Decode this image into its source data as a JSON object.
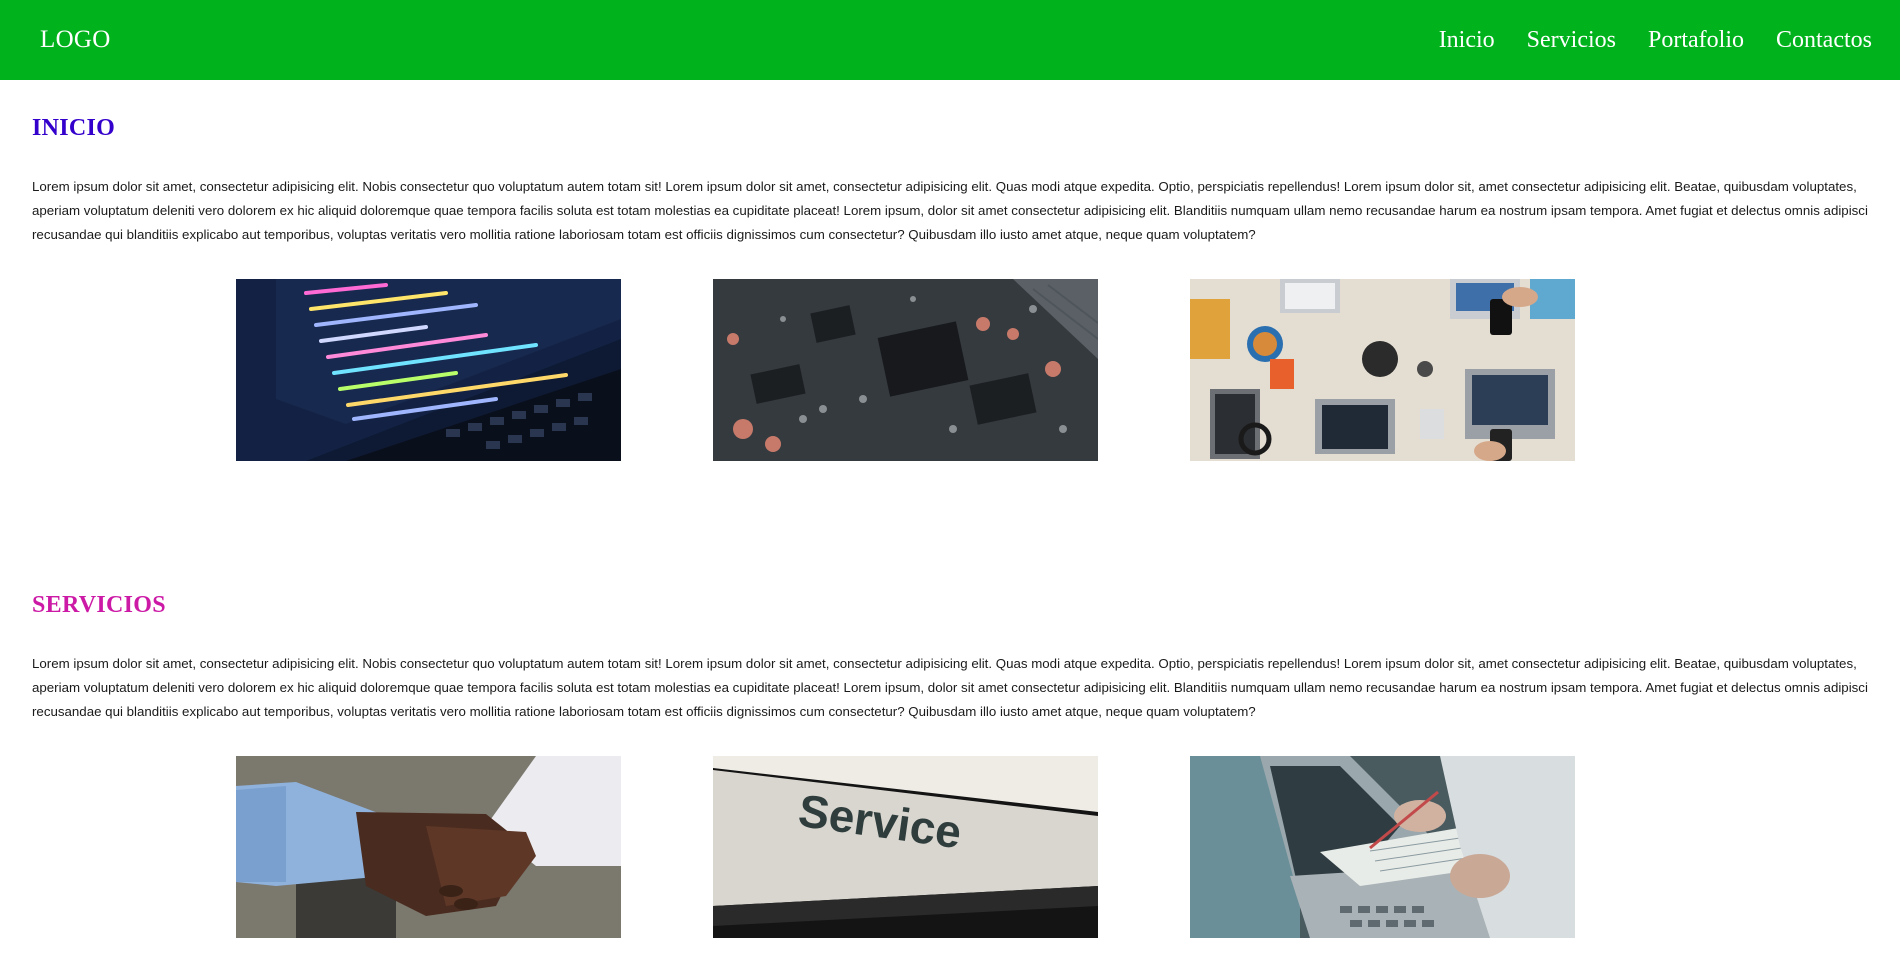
{
  "header": {
    "logo": "LOGO",
    "nav": [
      {
        "label": "Inicio"
      },
      {
        "label": "Servicios"
      },
      {
        "label": "Portafolio"
      },
      {
        "label": "Contactos"
      }
    ],
    "background_color": "#00b31c"
  },
  "sections": [
    {
      "title": "INICIO",
      "title_color": "#3300cc",
      "text": "Lorem ipsum dolor sit amet, consectetur adipisicing elit. Nobis consectetur quo voluptatum autem totam sit! Lorem ipsum dolor sit amet, consectetur adipisicing elit. Quas modi atque expedita. Optio, perspiciatis repellendus! Lorem ipsum dolor sit, amet consectetur adipisicing elit. Beatae, quibusdam voluptates, aperiam voluptatum deleniti vero dolorem ex hic aliquid doloremque quae tempora facilis soluta est totam molestias ea cupiditate placeat! Lorem ipsum, dolor sit amet consectetur adipisicing elit. Blanditiis numquam ullam nemo recusandae harum ea nostrum ipsam tempora. Amet fugiat et delectus omnis adipisci recusandae qui blanditiis explicabo aut temporibus, voluptas veritatis vero mollitia ratione laboriosam totam est officiis dignissimos cum consectetur? Quibusdam illo iusto amet atque, neque quam voluptatem?",
      "images": [
        "code-laptop-photo",
        "circuit-board-photo",
        "team-laptops-desk-photo"
      ]
    },
    {
      "title": "SERVICIOS",
      "title_color": "#cc1aa6",
      "text": "Lorem ipsum dolor sit amet, consectetur adipisicing elit. Nobis consectetur quo voluptatum autem totam sit! Lorem ipsum dolor sit amet, consectetur adipisicing elit. Quas modi atque expedita. Optio, perspiciatis repellendus! Lorem ipsum dolor sit, amet consectetur adipisicing elit. Beatae, quibusdam voluptates, aperiam voluptatum deleniti vero dolorem ex hic aliquid doloremque quae tempora facilis soluta est totam molestias ea cupiditate placeat! Lorem ipsum, dolor sit amet consectetur adipisicing elit. Blanditiis numquam ullam nemo recusandae harum ea nostrum ipsam tempora. Amet fugiat et delectus omnis adipisci recusandae qui blanditiis explicabo aut temporibus, voluptas veritatis vero mollitia ratione laboriosam totam est officiis dignissimos cum consectetur? Quibusdam illo iusto amet atque, neque quam voluptatem?",
      "images": [
        "handshake-photo",
        "service-sign-photo",
        "business-paperwork-photo"
      ],
      "service_sign_text": "Service"
    }
  ]
}
